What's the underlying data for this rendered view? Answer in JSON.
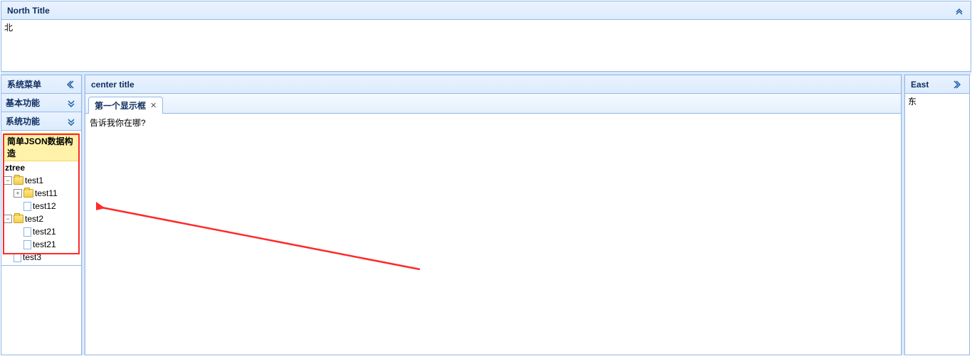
{
  "north": {
    "title": "North Title",
    "body_text": "北"
  },
  "west": {
    "title": "系统菜单",
    "groups": [
      {
        "title": "基本功能"
      },
      {
        "title": "系统功能"
      }
    ],
    "tree_legend": "简单JSON数据构造",
    "ztree_label": "ztree",
    "tree": {
      "n1": {
        "label": "test1",
        "toggle": "−"
      },
      "n11": {
        "label": "test11",
        "toggle": "+"
      },
      "n12": {
        "label": "test12"
      },
      "n2": {
        "label": "test2",
        "toggle": "−"
      },
      "n21": {
        "label": "test21"
      },
      "n22": {
        "label": "test21"
      },
      "n3": {
        "label": "test3"
      }
    }
  },
  "center": {
    "title": "center title",
    "tabs": [
      {
        "label": "第一个显示框"
      }
    ],
    "content_text": "告诉我你在哪?"
  },
  "east": {
    "title": "East",
    "body_text": "东"
  }
}
